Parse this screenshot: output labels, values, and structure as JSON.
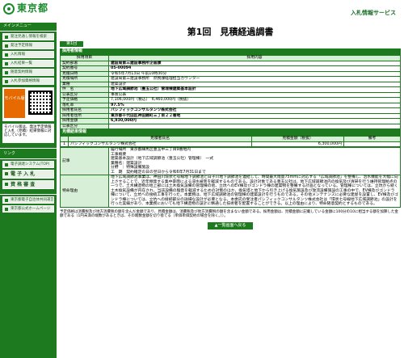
{
  "header": {
    "logo_text": "東京都",
    "system_title": "入札情報サービス"
  },
  "sidebar": {
    "menu_head": "メインメニュー",
    "items": [
      "発注見通し情報を検索",
      "発注予定情報",
      "入札情報",
      "入札結果一覧",
      "随意契約情報",
      "入札参加資格情報"
    ],
    "mobile_label": "モバイル版",
    "mobile_note": "モバイル版は、発注予定情報と入札（見積）結果情報に対応しています。",
    "links_head": "リンク",
    "link_items": [
      "電子調達システム(TOP)",
      "電 子 入 札",
      "資 格 審 査"
    ],
    "ext_items": [
      "東京都電子自治体共同運営",
      "東京都公式ホームページ"
    ]
  },
  "page": {
    "title": "第1回　見積経過調書",
    "round_tab": "第1回"
  },
  "sections": {
    "contractor": "採用者情報",
    "proc_item": "採用項目",
    "proc_content": "採用内容",
    "estimate": "見積結果情報"
  },
  "info_rows": [
    {
      "label": "契約部署",
      "value": "建設局第三建設事務所企画課",
      "bold": true
    },
    {
      "label": "契約番号",
      "value": "05-00094",
      "bold": true
    },
    {
      "label": "見積日時",
      "value": "令和5年7月13日 午前10時30分",
      "bold": false
    },
    {
      "label": "見積場所",
      "value": "建設局第三建設事務所　庶務課経理担当カウンター",
      "bold": false
    },
    {
      "label": "業種",
      "value": "建築設計",
      "bold": false
    },
    {
      "label": "件　名",
      "value": "地下広域調節池（豊玉公社）管理棟建築基本設計",
      "bold": true
    },
    {
      "label": "公表区分",
      "value": "事後公表",
      "bold": false
    },
    {
      "label": "予定価格",
      "value": "7,106,000円（税込）　6,460,000円（税抜）",
      "bold": false
    },
    {
      "label": "落札率",
      "value": "97.5%",
      "bold": true
    },
    {
      "label": "採用者氏名",
      "value": "パシフィックコンサルタンツ株式会社",
      "bold": true
    },
    {
      "label": "採用者住所",
      "value": "東京都千代田区神田錦町三丁目２２番地",
      "bold": true
    },
    {
      "label": "採用金額",
      "value": "6,930,000円",
      "bold": true
    },
    {
      "label": "公表区分",
      "value": "",
      "bold": false
    }
  ],
  "estimate_table": {
    "headers": [
      "見積者氏名",
      "見積金額（税抜）",
      "備考"
    ],
    "rows": [
      {
        "no": "1",
        "name": "パシフィックコンサルタンツ株式会社",
        "amount": "6,300,000円",
        "note": ""
      }
    ]
  },
  "notes": {
    "label": "記事",
    "lines": [
      "履行場所　東京都練馬区豊玉中三丁目9番地内",
      "工事概要",
      "建築基本設計（地下広域調節池（豊玉公社）管理棟）　一式",
      "業種名：建築設計",
      "分野　：特殊設備施設",
      "工　期　契約確定の日の翌日から令和6年7月31日まで"
    ]
  },
  "reason": {
    "label": "特命理由",
    "text": "地下広域調節池事業は、神田川環状七号線地下調節池と白子川地下調節池を連結して、時間最大雨量75mmに対応する「広域調節池」を整備し、治水機能を大幅に向上させることで、近年頻発する集中豪雨による浸水被害を軽減するものである。設計対象である豊玉公社は、地下広域調節池内の換気及び清掃を行う維持管理拠点の一つで、土木構造物の地上部には土木換気設備の管理棟の他、立坑へのEV棟及びゴンドラ棟の建築物を整備する計画となっている。管理棟については、立坑から続く土木換気設備が内在され、当該設備の騒音を軽減するための対策のほか、換気塔と地下から引き上げる換気施設及び放流設備施設の工事の中で、EV棟及びゴンドラ棟について、立坑への接続工事を行った。本業務は、地下広域調節池の管理棟の建築設計を行うものである。その他メンテナンスに必要な建屋を設置し、EV棟及びゴンドラ棟については、立坑への接続部分の詳細な設計が必要となる。本委託の受注者パシフィックコンサルタンツ株式会社は「環状七号線地下広域調節池」の設計を行った実績があり、本業務においても地下構造物の設計に精通した技術者を配置することができる。以上の理由により、特命随意契約とするものである。"
  },
  "footnote": "予定価格は消費税及び地方消費税の額を含んだ金額であり、見積金額は、消費税及び地方消費税の額を含まない金額である。採用金額は、見積金額に記載している金額に100分の10に相当する額を加算した金額である（1円未満の端数があるときは、その端数金額を切り捨てる（単価単価契約の場合を除く。））。",
  "back_button": "▲一覧画面へ戻る"
}
